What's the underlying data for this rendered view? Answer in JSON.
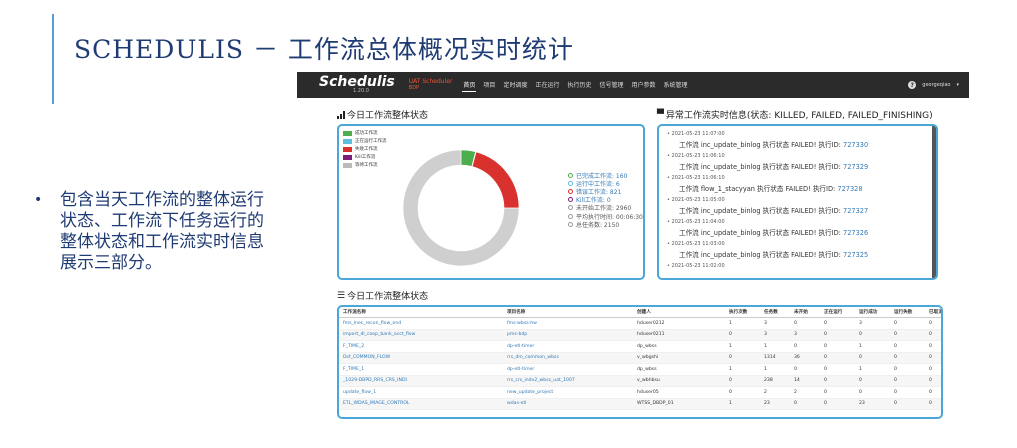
{
  "slide": {
    "title": "SCHEDULIS － 工作流总体概况实时统计",
    "bullet": "包含当天工作流的整体运行状态、工作流下任务运行的整体状态和工作流实时信息展示三部分。"
  },
  "app": {
    "brand": "Schedulis",
    "version": "1.20.0",
    "env_name": "UAT Scheduler",
    "env_sub": "BDP",
    "nav": [
      "首页",
      "项目",
      "定时调度",
      "正在运行",
      "执行历史",
      "信号管理",
      "用户参数",
      "系统管理"
    ],
    "active_nav": "首页",
    "user": "georgeqiao",
    "status_panel": {
      "title": "今日工作流整体状态",
      "legend": [
        {
          "label": "成功工作流",
          "color": "#4cae4c"
        },
        {
          "label": "正在运行工作流",
          "color": "#5bc0de"
        },
        {
          "label": "失败工作流",
          "color": "#d9322e"
        },
        {
          "label": "Kill工作流",
          "color": "#7b1e7a"
        },
        {
          "label": "等待工作流",
          "color": "#bbbbbb"
        }
      ],
      "stats": [
        {
          "label": "已完成工作流: 160",
          "tone": "blue"
        },
        {
          "label": "运行中工作流: 6",
          "tone": "blue"
        },
        {
          "label": "错误工作流: 821",
          "tone": "blue"
        },
        {
          "label": "Kill工作流: 0",
          "tone": "blue"
        },
        {
          "label": "未开始工作流: 2960",
          "tone": "gray"
        },
        {
          "label": "平均执行时间: 00:06:30",
          "tone": "gray"
        },
        {
          "label": "总任务数: 2150",
          "tone": "gray"
        }
      ],
      "donut": [
        {
          "name": "成功工作流",
          "value": 160,
          "color": "#4cae4c"
        },
        {
          "name": "正在运行工作流",
          "value": 6,
          "color": "#5bc0de"
        },
        {
          "name": "失败工作流",
          "value": 821,
          "color": "#d9322e"
        },
        {
          "name": "Kill工作流",
          "value": 0,
          "color": "#7b1e7a"
        },
        {
          "name": "等待工作流",
          "value": 2960,
          "color": "#cfcfcf"
        }
      ]
    },
    "abnormal_panel": {
      "title": "异常工作流实时信息(状态: KILLED, FAILED, FAILED_FINISHING)",
      "exec_label": "执行ID:",
      "entries": [
        {
          "time": "2021-05-23 11:07:00",
          "message": "工作流 inc_update_binlog 执行状态 FAILED!",
          "exec_id": "727330"
        },
        {
          "time": "2021-05-23 11:06:10",
          "message": "工作流 inc_update_binlog 执行状态 FAILED!",
          "exec_id": "727329"
        },
        {
          "time": "2021-05-23 11:06:10",
          "message": "工作流 flow_1_stacyyan 执行状态 FAILED!",
          "exec_id": "727328"
        },
        {
          "time": "2021-05-23 11:05:00",
          "message": "工作流 inc_update_binlog 执行状态 FAILED!",
          "exec_id": "727327"
        },
        {
          "time": "2021-05-23 11:04:00",
          "message": "工作流 inc_update_binlog 执行状态 FAILED!",
          "exec_id": "727326"
        },
        {
          "time": "2021-05-23 11:03:00",
          "message": "工作流 inc_update_binlog 执行状态 FAILED!",
          "exec_id": "727325"
        },
        {
          "time": "2021-05-23 11:02:00",
          "message": "",
          "exec_id": ""
        }
      ]
    },
    "table_panel": {
      "title": "今日工作流整体状态",
      "columns": [
        "工作流名称",
        "项目名称",
        "创建人",
        "执行次数",
        "任务数",
        "未开始",
        "正在运行",
        "运行成功",
        "运行失败",
        "已取消"
      ],
      "rows": [
        [
          "fms_lnec_recon_flow_end",
          "fms-wbss-hw",
          "hduser0212",
          "1",
          "3",
          "0",
          "0",
          "3",
          "0",
          "0"
        ],
        [
          "import_dl_coop_bank_acct_flow",
          "pms-bdp",
          "hduser0211",
          "0",
          "3",
          "3",
          "0",
          "0",
          "0",
          "0"
        ],
        [
          "F_TIME_2",
          "dp-etl-timer",
          "dp_wbss",
          "1",
          "1",
          "0",
          "0",
          "1",
          "0",
          "0"
        ],
        [
          "Dsf_COMMON_FLOW",
          "rrs_dm_common_wbss",
          "v_wbgshi",
          "0",
          "1314",
          "36",
          "0",
          "0",
          "0",
          "0"
        ],
        [
          "F_TIME_1",
          "dp-etl-timer",
          "dp_wbss",
          "1",
          "1",
          "0",
          "0",
          "1",
          "0",
          "0"
        ],
        [
          "_1029-DBPD_RRS_CRS_INDI",
          "rrs_crs_indv2_wbss_uat_1007",
          "v_wbhbsu",
          "0",
          "238",
          "14",
          "0",
          "0",
          "0",
          "0"
        ],
        [
          "update_flow_1",
          "new_update_project",
          "hduser05",
          "0",
          "2",
          "2",
          "0",
          "0",
          "0",
          "0"
        ],
        [
          "ETL_WDAS_IMAGE_CONTROL",
          "wdas-etl",
          "WTSS_DBDP_01",
          "1",
          "23",
          "0",
          "0",
          "23",
          "0",
          "0"
        ]
      ]
    }
  }
}
